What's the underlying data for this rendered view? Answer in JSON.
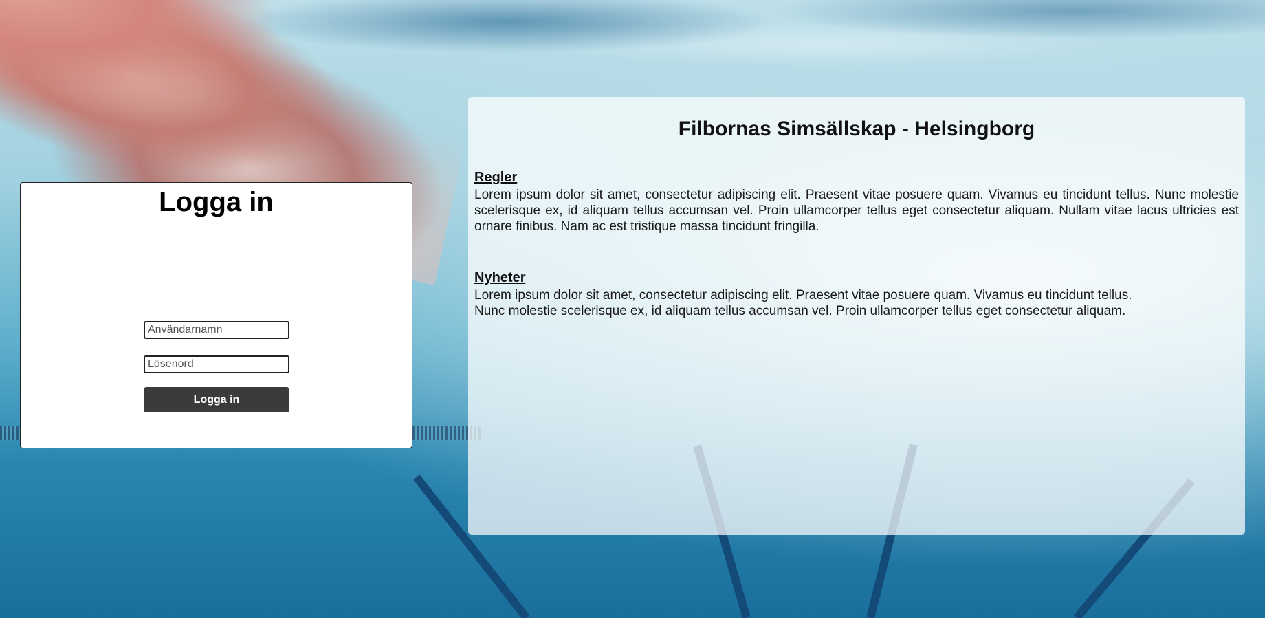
{
  "login": {
    "title": "Logga in",
    "username_placeholder": "Användarnamn",
    "password_placeholder": "Lösenord",
    "submit_label": "Logga in"
  },
  "info": {
    "title": "Filbornas Simsällskap - Helsingborg",
    "sections": [
      {
        "heading": "Regler",
        "text": "Lorem ipsum dolor sit amet, consectetur adipiscing elit. Praesent vitae posuere quam. Vivamus eu tincidunt tellus. Nunc molestie scelerisque ex, id aliquam tellus accumsan vel. Proin ullamcorper tellus eget consectetur aliquam. Nullam vitae lacus ultricies est ornare finibus. Nam ac est tristique massa tincidunt fringilla."
      },
      {
        "heading": "Nyheter",
        "lines": [
          "Lorem ipsum dolor sit amet, consectetur adipiscing elit. Praesent vitae posuere quam. Vivamus eu tincidunt tellus.",
          "Nunc molestie scelerisque ex, id aliquam tellus accumsan vel. Proin ullamcorper tellus eget consectetur aliquam."
        ]
      }
    ]
  }
}
